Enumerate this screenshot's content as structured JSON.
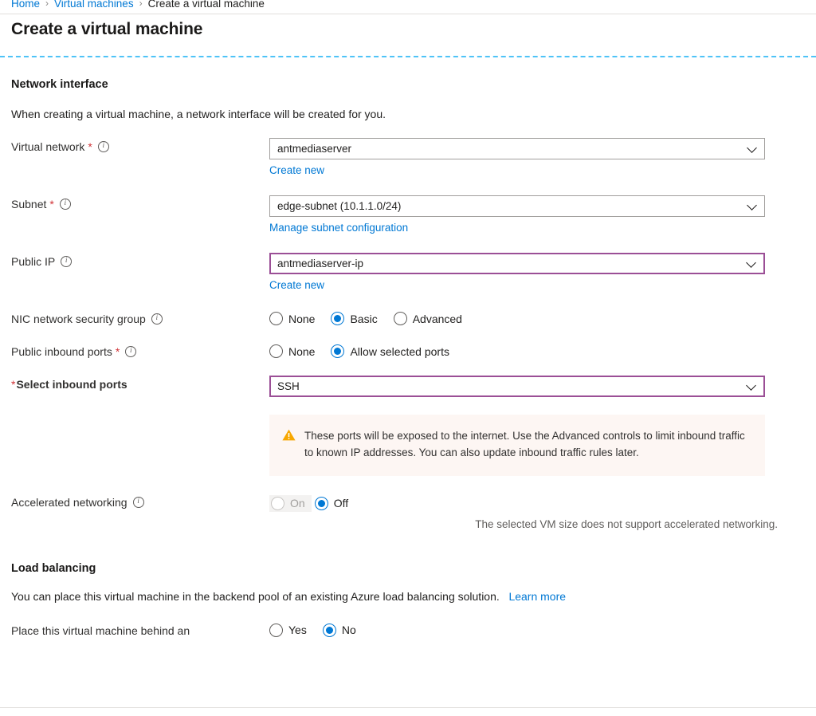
{
  "breadcrumb": {
    "home": "Home",
    "virtual_machines": "Virtual machines",
    "current": "Create a virtual machine",
    "separator": "›"
  },
  "page": {
    "title": "Create a virtual machine"
  },
  "network_interface": {
    "heading": "Network interface",
    "description": "When creating a virtual machine, a network interface will be created for you.",
    "virtual_network": {
      "label": "Virtual network",
      "value": "antmediaserver",
      "sub_link": "Create new"
    },
    "subnet": {
      "label": "Subnet",
      "value": "edge-subnet (10.1.1.0/24)",
      "sub_link": "Manage subnet configuration"
    },
    "public_ip": {
      "label": "Public IP",
      "value": "antmediaserver-ip",
      "sub_link": "Create new"
    },
    "nic_nsg": {
      "label": "NIC network security group",
      "options": [
        "None",
        "Basic",
        "Advanced"
      ],
      "selected": "Basic"
    },
    "public_inbound_ports": {
      "label": "Public inbound ports",
      "options": [
        "None",
        "Allow selected ports"
      ],
      "selected": "Allow selected ports"
    },
    "select_inbound_ports": {
      "label": "Select inbound ports",
      "value": "SSH"
    },
    "warning": {
      "icon": "warning-triangle-icon",
      "text": "These ports will be exposed to the internet. Use the Advanced controls to limit inbound traffic to known IP addresses. You can also update inbound traffic rules later."
    },
    "accelerated_networking": {
      "label": "Accelerated networking",
      "options": [
        "On",
        "Off"
      ],
      "selected": "Off",
      "disabled_option": "On",
      "helper": "The selected VM size does not support accelerated networking."
    }
  },
  "load_balancing": {
    "heading": "Load balancing",
    "description": "You can place this virtual machine in the backend pool of an existing Azure load balancing solution.",
    "learn_more": "Learn more",
    "place_behind": {
      "label": "Place this virtual machine behind an",
      "options": [
        "Yes",
        "No"
      ],
      "selected": "No"
    }
  },
  "colors": {
    "accent": "#0078d4",
    "required": "#d13438",
    "focus_border": "#9b4f96",
    "warning_bg": "#fdf6f3",
    "warning_icon": "#f7a700",
    "dashed_rule": "#4fc3f7"
  }
}
